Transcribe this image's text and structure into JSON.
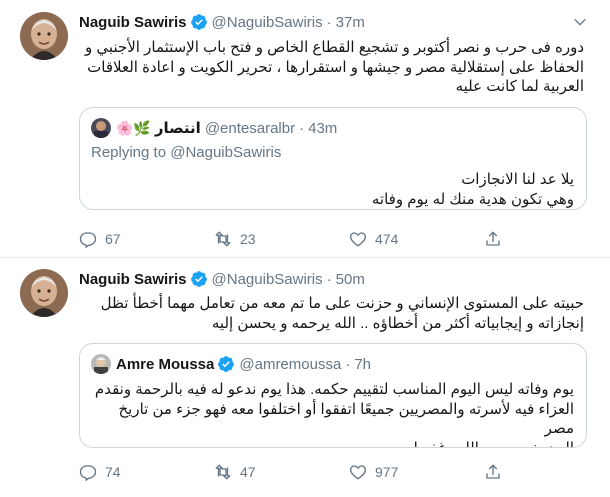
{
  "tweets": [
    {
      "name": "Naguib Sawiris",
      "handle": "@NaguibSawiris",
      "dot": "·",
      "time": "37m",
      "text_lines": [
        "دوره فى حرب و نصر أكتوبر و تشجيع القطاع الخاص و فتح باب الإستثمار الأجنبي و",
        "الحفاظ على إستقلالية مصر و جيشها و استقرارها ، تحرير الكويت و اعادة العلاقات",
        "العربية لما كانت عليه"
      ],
      "quote": {
        "name": "انتصار",
        "emojis": "🌸🌿",
        "handle": "@entesaralbr",
        "dot": "·",
        "time": "43m",
        "replying": "Replying to @NaguibSawiris",
        "text_lines": [
          "يلا عد لنا الانجازات",
          "وهي تكون هدية منك له يوم وفاته"
        ]
      },
      "stats": {
        "replies": "67",
        "retweets": "23",
        "likes": "474"
      }
    },
    {
      "name": "Naguib Sawiris",
      "handle": "@NaguibSawiris",
      "dot": "·",
      "time": "50m",
      "text_lines": [
        "حبيته على المستوى الإنساني و حزنت على ما تم معه من تعامل مهما أخطأ تظل",
        "إنجازاته و إيجابياته أكثر من أخطاؤه .. الله يرحمه و يحسن إليه"
      ],
      "quote": {
        "name": "Amre Moussa",
        "handle": "@amremoussa",
        "dot": "·",
        "time": "7h",
        "text_lines": [
          "يوم وفاته ليس اليوم المناسب لتقييم حكمه. هذا يوم ندعو له فيه بالرحمة ونقدم",
          "العزاء فيه لأسرته والمصريين جميعًا اتفقوا أو اختلفوا معه فهو جزء من تاريخ مصر",
          "الحديث . رحمه الله وغفر له ."
        ]
      },
      "stats": {
        "replies": "74",
        "retweets": "47",
        "likes": "977"
      }
    }
  ],
  "colors": {
    "verified": "#1da1f2",
    "secondary_text": "#657786",
    "border": "#ccd6dd"
  },
  "icons": [
    "avatar",
    "verified-badge-icon",
    "chevron-down-icon",
    "reply-icon",
    "retweet-icon",
    "like-icon",
    "share-icon"
  ]
}
